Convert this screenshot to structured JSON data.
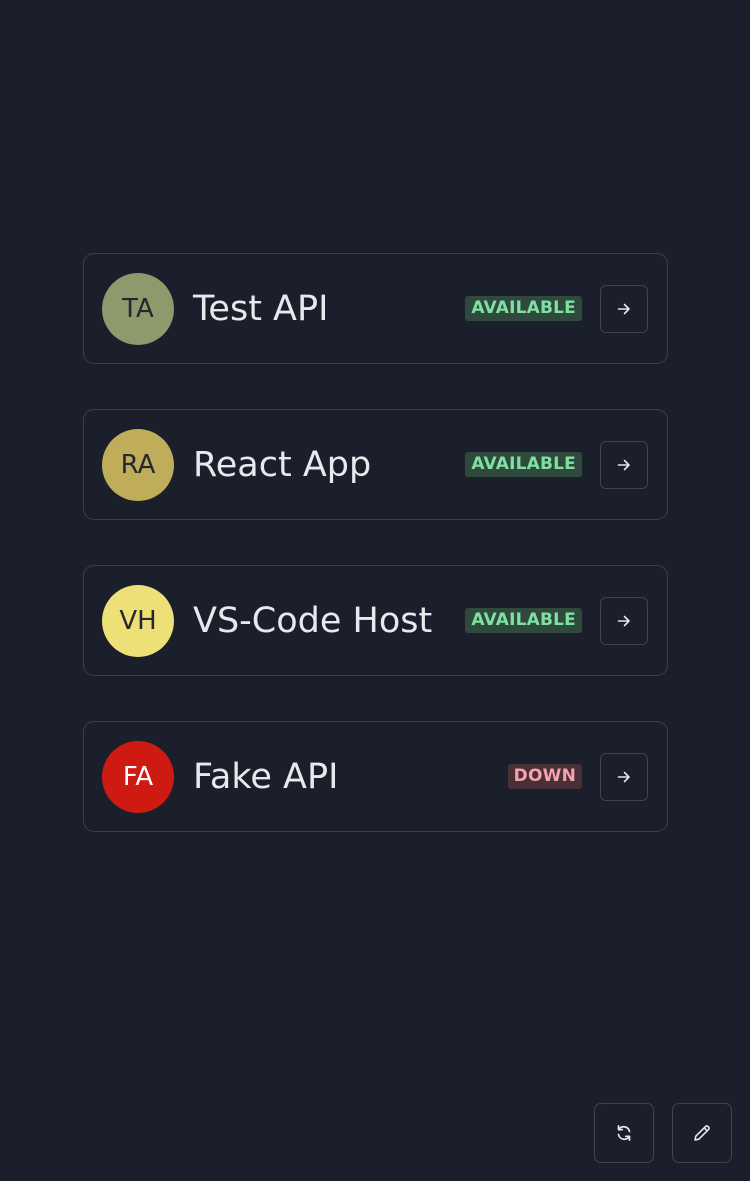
{
  "services": [
    {
      "initials": "TA",
      "name": "Test API",
      "status": "AVAILABLE",
      "avatar_color": "#8f9a6c",
      "initials_color": "#23272f",
      "badge_bg": "#2f4a3d",
      "badge_fg": "#7ee0a1",
      "open_icon": "arrow-right-icon"
    },
    {
      "initials": "RA",
      "name": "React App",
      "status": "AVAILABLE",
      "avatar_color": "#c0ad5a",
      "initials_color": "#23272f",
      "badge_bg": "#2f4a3d",
      "badge_fg": "#7ee0a1",
      "open_icon": "arrow-right-icon"
    },
    {
      "initials": "VH",
      "name": "VS-Code Host",
      "status": "AVAILABLE",
      "avatar_color": "#ede077",
      "initials_color": "#23272f",
      "badge_bg": "#2f4a3d",
      "badge_fg": "#7ee0a1",
      "open_icon": "arrow-right-icon"
    },
    {
      "initials": "FA",
      "name": "Fake API",
      "status": "DOWN",
      "avatar_color": "#cf1a12",
      "initials_color": "#ffffff",
      "badge_bg": "#4a2f36",
      "badge_fg": "#f3a3ad",
      "open_icon": "arrow-right-icon"
    }
  ],
  "footer": {
    "refresh_icon": "refresh-icon",
    "edit_icon": "pencil-icon"
  },
  "colors": {
    "background": "#1b1f2b",
    "border": "#3a3f4c",
    "text": "#e8e9ec"
  }
}
